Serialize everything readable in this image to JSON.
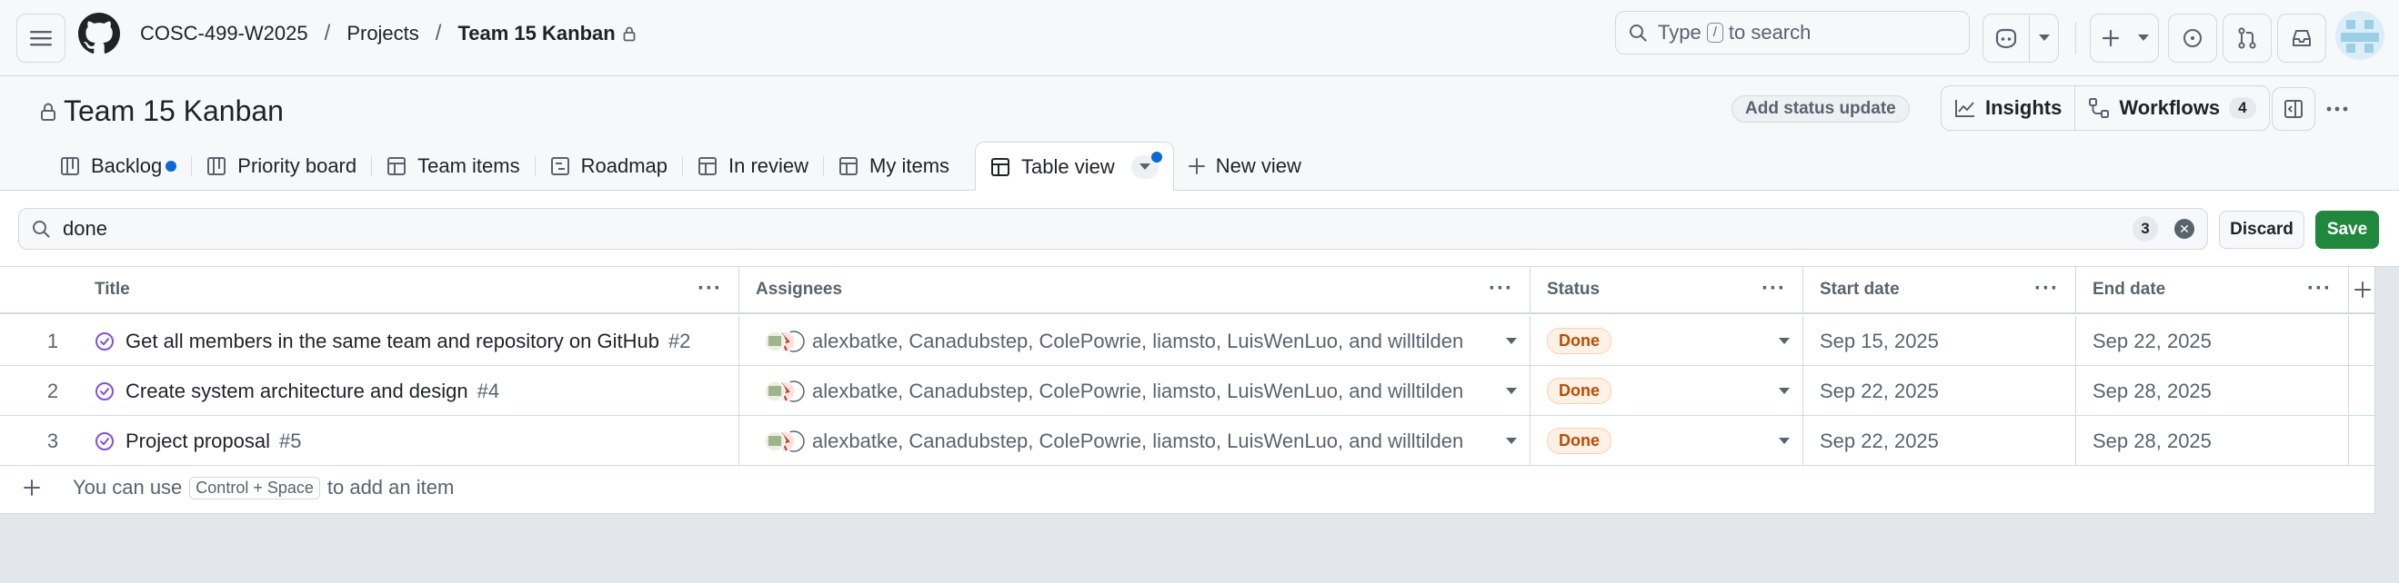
{
  "header": {
    "breadcrumb": [
      "COSC-499-W2025",
      "Projects",
      "Team 15 Kanban"
    ],
    "search_prefix": "Type",
    "search_key": "/",
    "search_suffix": "to search"
  },
  "project": {
    "title": "Team 15 Kanban",
    "status_button": "Add status update",
    "insights_label": "Insights",
    "workflows_label": "Workflows",
    "workflows_count": "4"
  },
  "tabs": [
    {
      "label": "Backlog",
      "icon": "board-icon"
    },
    {
      "label": "Priority board",
      "icon": "board-icon"
    },
    {
      "label": "Team items",
      "icon": "table-icon"
    },
    {
      "label": "Roadmap",
      "icon": "roadmap-icon"
    },
    {
      "label": "In review",
      "icon": "table-icon"
    },
    {
      "label": "My items",
      "icon": "table-icon"
    },
    {
      "label": "Table view",
      "icon": "table-icon"
    },
    {
      "label": "New view",
      "icon": "plus-icon"
    }
  ],
  "filter": {
    "query": "done",
    "count": "3",
    "discard_label": "Discard",
    "save_label": "Save"
  },
  "table": {
    "columns": [
      "Title",
      "Assignees",
      "Status",
      "Start date",
      "End date"
    ],
    "rows": [
      {
        "num": "1",
        "title": "Get all members in the same team and repository on GitHub",
        "issue": "#2",
        "assignees": "alexbatke, Canadubstep, ColePowrie, liamsto, LuisWenLuo, and willtilden",
        "status": "Done",
        "start": "Sep 15, 2025",
        "end": "Sep 22, 2025"
      },
      {
        "num": "2",
        "title": "Create system architecture and design",
        "issue": "#4",
        "assignees": "alexbatke, Canadubstep, ColePowrie, liamsto, LuisWenLuo, and willtilden",
        "status": "Done",
        "start": "Sep 22, 2025",
        "end": "Sep 28, 2025"
      },
      {
        "num": "3",
        "title": "Project proposal",
        "issue": "#5",
        "assignees": "alexbatke, Canadubstep, ColePowrie, liamsto, LuisWenLuo, and willtilden",
        "status": "Done",
        "start": "Sep 22, 2025",
        "end": "Sep 28, 2025"
      }
    ],
    "add_prefix": "You can use",
    "add_kbd": "Control + Space",
    "add_suffix": "to add an item"
  },
  "colors": {
    "accent": "#0969da",
    "done_text": "#bc4c00",
    "done_bg": "#fff1e5",
    "save_bg": "#1f883d",
    "issue_closed": "#8250df"
  }
}
